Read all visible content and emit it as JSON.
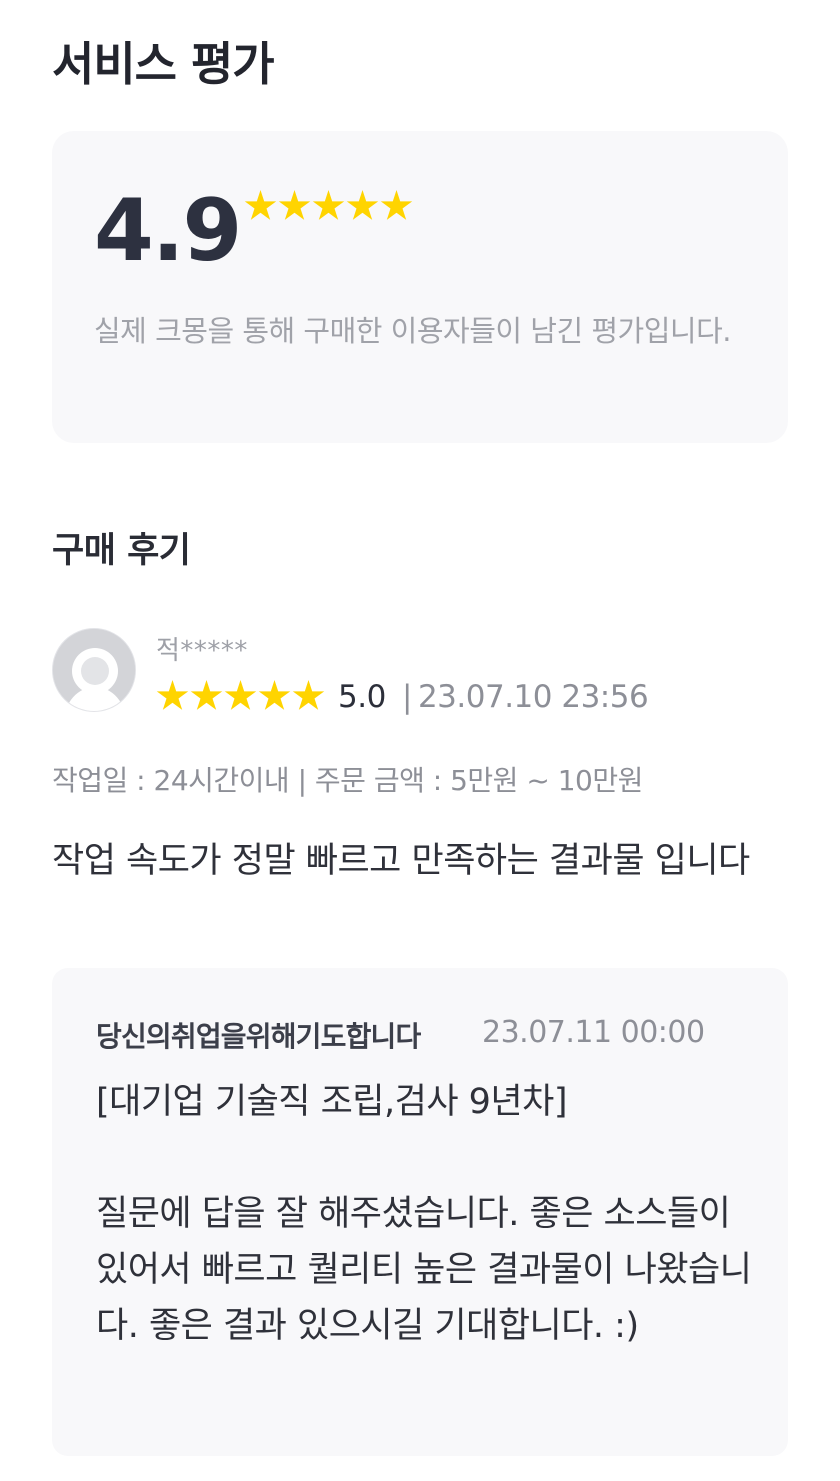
{
  "service_rating": {
    "title": "서비스 평가",
    "average_score": "4.9",
    "star_rating": 5,
    "star_color": "#ffd400",
    "description": "실제 크몽을 통해 구매한 이용자들이 남긴 평가입니다."
  },
  "reviews_section": {
    "title": "구매 후기",
    "reviews": [
      {
        "avatar_icon": "default-user-avatar-icon",
        "reviewer_name": "적*****",
        "star_rating": 5,
        "score": "5.0",
        "separator": "|",
        "date": "23.07.10 23:56",
        "meta": "작업일 : 24시간이내 | 주문 금액 : 5만원 ~ 10만원",
        "text": "작업 속도가 정말 빠르고 만족하는 결과물 입니다",
        "reply": {
          "author": "당신의취업을위해기도합니다",
          "date": "23.07.11 00:00",
          "text": "[대기업 기술직 조립,검사 9년차]\n\n질문에 답을 잘 해주셨습니다. 좋은 소스들이 있어서 빠르고 퀄리티 높은 결과물이 나왔습니다. 좋은 결과 있으시길 기대합니다. :)"
        }
      }
    ]
  }
}
